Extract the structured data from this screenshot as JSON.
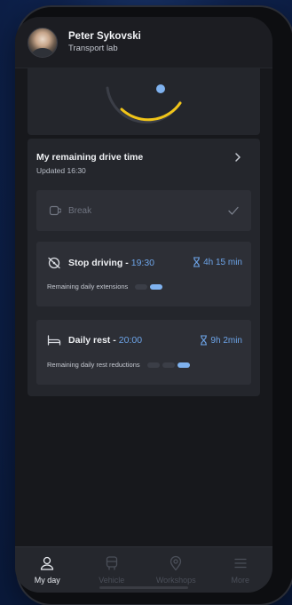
{
  "user": {
    "name": "Peter Sykovski",
    "org": "Transport lab"
  },
  "drive": {
    "title": "My remaining drive time",
    "updated": "Updated 16:30",
    "break_label": "Break",
    "stop": {
      "title": "Stop driving",
      "separator": "-",
      "time": "19:30",
      "duration": "4h 15 min",
      "sub": "Remaining daily extensions",
      "pills": [
        false,
        true
      ]
    },
    "rest": {
      "title": "Daily rest",
      "separator": "-",
      "time": "20:00",
      "duration": "9h 2min",
      "sub": "Remaining daily rest reductions",
      "pills": [
        false,
        false,
        true
      ]
    }
  },
  "tabs": [
    {
      "label": "My day",
      "active": true
    },
    {
      "label": "Vehicle",
      "active": false
    },
    {
      "label": "Workshops",
      "active": false
    },
    {
      "label": "More",
      "active": false
    }
  ],
  "colors": {
    "accent": "#6da4e8",
    "pill_on": "#7fb2ef",
    "gauge": "#f0c419"
  }
}
